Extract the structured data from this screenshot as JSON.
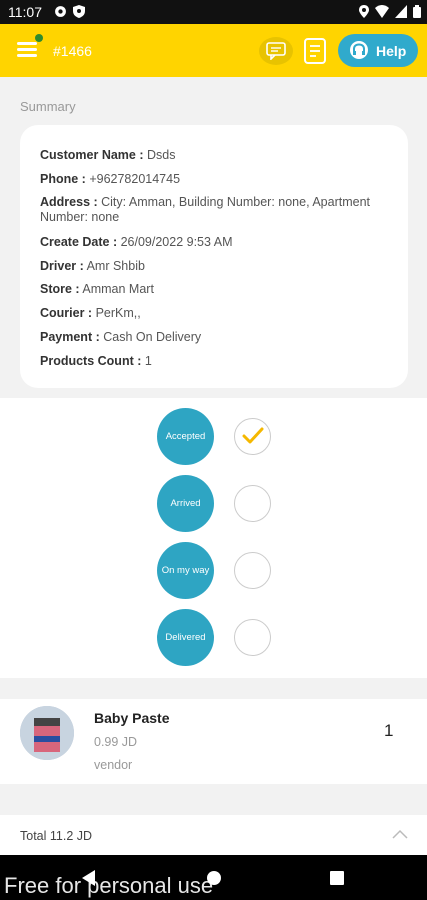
{
  "status_bar": {
    "time": "11:07"
  },
  "header": {
    "order_number": "#1466",
    "help_label": "Help",
    "accent": "#ffd400",
    "help_color": "#30aacc"
  },
  "summary": {
    "section_label": "Summary",
    "rows": [
      {
        "label": "Customer Name :",
        "value": " Dsds"
      },
      {
        "label": "Phone :",
        "value": " +962782014745"
      },
      {
        "label": "Address :",
        "value": " City: Amman, Building Number: none, Apartment Number: none"
      },
      {
        "label": "Create Date :",
        "value": " 26/09/2022  9:53 AM"
      },
      {
        "label": "Driver :",
        "value": " Amr Shbib"
      },
      {
        "label": "Store :",
        "value": " Amman Mart"
      },
      {
        "label": "Courier :",
        "value": " PerKm,,"
      },
      {
        "label": "Payment :",
        "value": " Cash On Delivery"
      },
      {
        "label": "Products Count :",
        "value": " 1"
      }
    ]
  },
  "order_status": {
    "color": "#2ea5c3",
    "steps": [
      {
        "label": "Accepted",
        "checked": true
      },
      {
        "label": "Arrived",
        "checked": false
      },
      {
        "label": "On my way",
        "checked": false
      },
      {
        "label": "Delivered",
        "checked": false
      }
    ]
  },
  "product": {
    "name": "Baby Paste",
    "price": "0.99  JD",
    "vendor": "vendor",
    "quantity": "1"
  },
  "footer": {
    "total": "Total 11.2  JD"
  },
  "watermark": "Free for personal use",
  "icons": [
    "settings-icon",
    "shield-icon",
    "location-icon",
    "wifi-icon",
    "signal-icon",
    "battery-icon",
    "menu-icon",
    "chat-icon",
    "notes-icon",
    "headset-icon",
    "check-icon",
    "chevron-up-icon",
    "back-icon",
    "home-icon",
    "recents-icon"
  ]
}
